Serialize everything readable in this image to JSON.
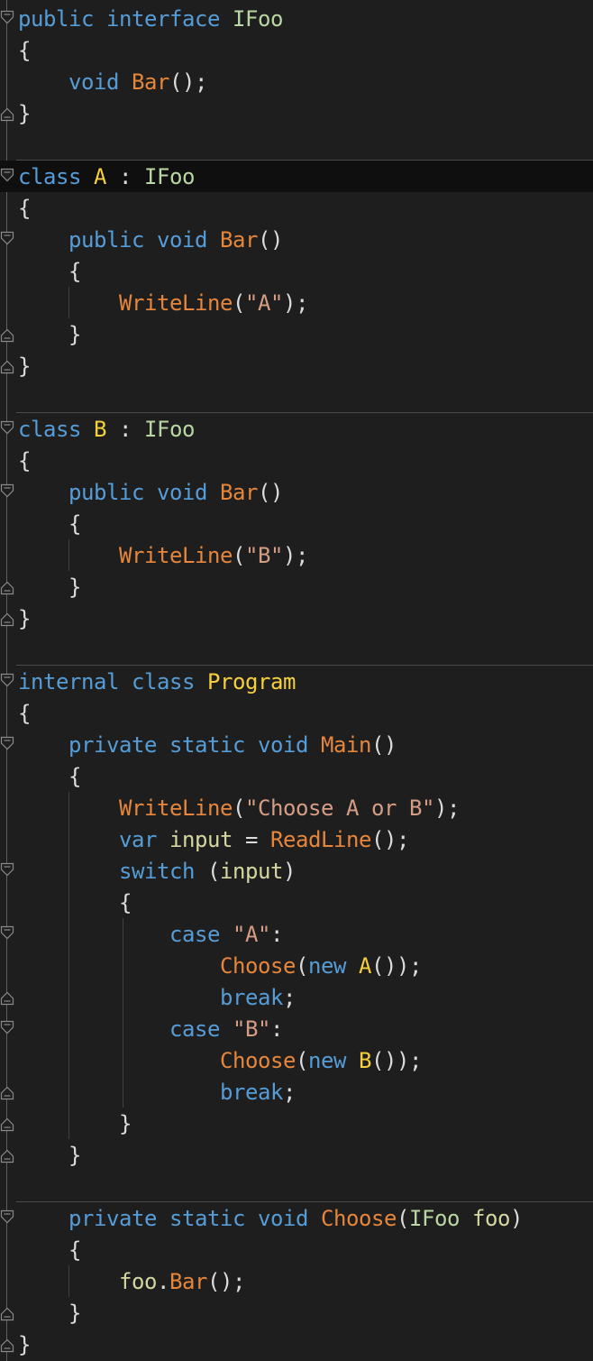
{
  "editor": {
    "language": "C#",
    "colors": {
      "background": "#1e1e1e",
      "current_line": "#0f0f0f",
      "keyword": "#569cd6",
      "interface": "#b8d7a3",
      "class": "#f5d03c",
      "method": "#e6863c",
      "string": "#d69d85",
      "variable": "#d6d6a0",
      "punctuation": "#dcdcdc"
    },
    "lines": [
      {
        "tokens": [
          {
            "t": "public",
            "k": "keyword"
          },
          {
            "t": " "
          },
          {
            "t": "interface",
            "k": "keyword"
          },
          {
            "t": " "
          },
          {
            "t": "IFoo",
            "k": "iface"
          }
        ]
      },
      {
        "tokens": [
          {
            "t": "{",
            "k": "punct"
          }
        ]
      },
      {
        "tokens": [
          {
            "t": "    "
          },
          {
            "t": "void",
            "k": "keyword"
          },
          {
            "t": " "
          },
          {
            "t": "Bar",
            "k": "method"
          },
          {
            "t": "();",
            "k": "punct"
          }
        ]
      },
      {
        "tokens": [
          {
            "t": "}",
            "k": "punct"
          }
        ]
      },
      {
        "tokens": []
      },
      {
        "current": true,
        "tokens": [
          {
            "t": "class",
            "k": "keyword"
          },
          {
            "t": " "
          },
          {
            "t": "A",
            "k": "class"
          },
          {
            "t": " : ",
            "k": "punct"
          },
          {
            "t": "IFoo",
            "k": "iface"
          }
        ]
      },
      {
        "tokens": [
          {
            "t": "{",
            "k": "punct"
          }
        ]
      },
      {
        "tokens": [
          {
            "t": "    "
          },
          {
            "t": "public",
            "k": "keyword"
          },
          {
            "t": " "
          },
          {
            "t": "void",
            "k": "keyword"
          },
          {
            "t": " "
          },
          {
            "t": "Bar",
            "k": "method"
          },
          {
            "t": "()",
            "k": "punct"
          }
        ]
      },
      {
        "tokens": [
          {
            "t": "    "
          },
          {
            "t": "{",
            "k": "punct"
          }
        ]
      },
      {
        "tokens": [
          {
            "t": "        "
          },
          {
            "t": "WriteLine",
            "k": "method"
          },
          {
            "t": "(",
            "k": "punct"
          },
          {
            "t": "\"A\"",
            "k": "string"
          },
          {
            "t": ");",
            "k": "punct"
          }
        ]
      },
      {
        "tokens": [
          {
            "t": "    "
          },
          {
            "t": "}",
            "k": "punct"
          }
        ]
      },
      {
        "tokens": [
          {
            "t": "}",
            "k": "punct"
          }
        ]
      },
      {
        "tokens": []
      },
      {
        "tokens": [
          {
            "t": "class",
            "k": "keyword"
          },
          {
            "t": " "
          },
          {
            "t": "B",
            "k": "class"
          },
          {
            "t": " : ",
            "k": "punct"
          },
          {
            "t": "IFoo",
            "k": "iface"
          }
        ]
      },
      {
        "tokens": [
          {
            "t": "{",
            "k": "punct"
          }
        ]
      },
      {
        "tokens": [
          {
            "t": "    "
          },
          {
            "t": "public",
            "k": "keyword"
          },
          {
            "t": " "
          },
          {
            "t": "void",
            "k": "keyword"
          },
          {
            "t": " "
          },
          {
            "t": "Bar",
            "k": "method"
          },
          {
            "t": "()",
            "k": "punct"
          }
        ]
      },
      {
        "tokens": [
          {
            "t": "    "
          },
          {
            "t": "{",
            "k": "punct"
          }
        ]
      },
      {
        "tokens": [
          {
            "t": "        "
          },
          {
            "t": "WriteLine",
            "k": "method"
          },
          {
            "t": "(",
            "k": "punct"
          },
          {
            "t": "\"B\"",
            "k": "string"
          },
          {
            "t": ");",
            "k": "punct"
          }
        ]
      },
      {
        "tokens": [
          {
            "t": "    "
          },
          {
            "t": "}",
            "k": "punct"
          }
        ]
      },
      {
        "tokens": [
          {
            "t": "}",
            "k": "punct"
          }
        ]
      },
      {
        "tokens": []
      },
      {
        "tokens": [
          {
            "t": "internal",
            "k": "keyword"
          },
          {
            "t": " "
          },
          {
            "t": "class",
            "k": "keyword"
          },
          {
            "t": " "
          },
          {
            "t": "Program",
            "k": "class"
          }
        ]
      },
      {
        "tokens": [
          {
            "t": "{",
            "k": "punct"
          }
        ]
      },
      {
        "tokens": [
          {
            "t": "    "
          },
          {
            "t": "private",
            "k": "keyword"
          },
          {
            "t": " "
          },
          {
            "t": "static",
            "k": "keyword"
          },
          {
            "t": " "
          },
          {
            "t": "void",
            "k": "keyword"
          },
          {
            "t": " "
          },
          {
            "t": "Main",
            "k": "method"
          },
          {
            "t": "()",
            "k": "punct"
          }
        ]
      },
      {
        "tokens": [
          {
            "t": "    "
          },
          {
            "t": "{",
            "k": "punct"
          }
        ]
      },
      {
        "tokens": [
          {
            "t": "        "
          },
          {
            "t": "WriteLine",
            "k": "method"
          },
          {
            "t": "(",
            "k": "punct"
          },
          {
            "t": "\"Choose A or B\"",
            "k": "string"
          },
          {
            "t": ");",
            "k": "punct"
          }
        ]
      },
      {
        "tokens": [
          {
            "t": "        "
          },
          {
            "t": "var",
            "k": "keyword"
          },
          {
            "t": " "
          },
          {
            "t": "input",
            "k": "var"
          },
          {
            "t": " = ",
            "k": "punct"
          },
          {
            "t": "ReadLine",
            "k": "method"
          },
          {
            "t": "();",
            "k": "punct"
          }
        ]
      },
      {
        "tokens": [
          {
            "t": "        "
          },
          {
            "t": "switch",
            "k": "keyword"
          },
          {
            "t": " (",
            "k": "punct"
          },
          {
            "t": "input",
            "k": "var"
          },
          {
            "t": ")",
            "k": "punct"
          }
        ]
      },
      {
        "tokens": [
          {
            "t": "        "
          },
          {
            "t": "{",
            "k": "punct"
          }
        ]
      },
      {
        "tokens": [
          {
            "t": "            "
          },
          {
            "t": "case",
            "k": "keyword"
          },
          {
            "t": " "
          },
          {
            "t": "\"A\"",
            "k": "string"
          },
          {
            "t": ":",
            "k": "punct"
          }
        ]
      },
      {
        "tokens": [
          {
            "t": "                "
          },
          {
            "t": "Choose",
            "k": "method"
          },
          {
            "t": "(",
            "k": "punct"
          },
          {
            "t": "new",
            "k": "keyword"
          },
          {
            "t": " "
          },
          {
            "t": "A",
            "k": "class"
          },
          {
            "t": "());",
            "k": "punct"
          }
        ]
      },
      {
        "tokens": [
          {
            "t": "                "
          },
          {
            "t": "break",
            "k": "keyword"
          },
          {
            "t": ";",
            "k": "punct"
          }
        ]
      },
      {
        "tokens": [
          {
            "t": "            "
          },
          {
            "t": "case",
            "k": "keyword"
          },
          {
            "t": " "
          },
          {
            "t": "\"B\"",
            "k": "string"
          },
          {
            "t": ":",
            "k": "punct"
          }
        ]
      },
      {
        "tokens": [
          {
            "t": "                "
          },
          {
            "t": "Choose",
            "k": "method"
          },
          {
            "t": "(",
            "k": "punct"
          },
          {
            "t": "new",
            "k": "keyword"
          },
          {
            "t": " "
          },
          {
            "t": "B",
            "k": "class"
          },
          {
            "t": "());",
            "k": "punct"
          }
        ]
      },
      {
        "tokens": [
          {
            "t": "                "
          },
          {
            "t": "break",
            "k": "keyword"
          },
          {
            "t": ";",
            "k": "punct"
          }
        ]
      },
      {
        "tokens": [
          {
            "t": "        "
          },
          {
            "t": "}",
            "k": "punct"
          }
        ]
      },
      {
        "tokens": [
          {
            "t": "    "
          },
          {
            "t": "}",
            "k": "punct"
          }
        ]
      },
      {
        "tokens": []
      },
      {
        "tokens": [
          {
            "t": "    "
          },
          {
            "t": "private",
            "k": "keyword"
          },
          {
            "t": " "
          },
          {
            "t": "static",
            "k": "keyword"
          },
          {
            "t": " "
          },
          {
            "t": "void",
            "k": "keyword"
          },
          {
            "t": " "
          },
          {
            "t": "Choose",
            "k": "method"
          },
          {
            "t": "(",
            "k": "punct"
          },
          {
            "t": "IFoo",
            "k": "iface"
          },
          {
            "t": " "
          },
          {
            "t": "foo",
            "k": "var"
          },
          {
            "t": ")",
            "k": "punct"
          }
        ]
      },
      {
        "tokens": [
          {
            "t": "    "
          },
          {
            "t": "{",
            "k": "punct"
          }
        ]
      },
      {
        "tokens": [
          {
            "t": "        "
          },
          {
            "t": "foo",
            "k": "var"
          },
          {
            "t": ".",
            "k": "punct"
          },
          {
            "t": "Bar",
            "k": "method"
          },
          {
            "t": "();",
            "k": "punct"
          }
        ]
      },
      {
        "tokens": [
          {
            "t": "    "
          },
          {
            "t": "}",
            "k": "punct"
          }
        ]
      },
      {
        "tokens": [
          {
            "t": "}",
            "k": "punct"
          }
        ]
      }
    ]
  }
}
